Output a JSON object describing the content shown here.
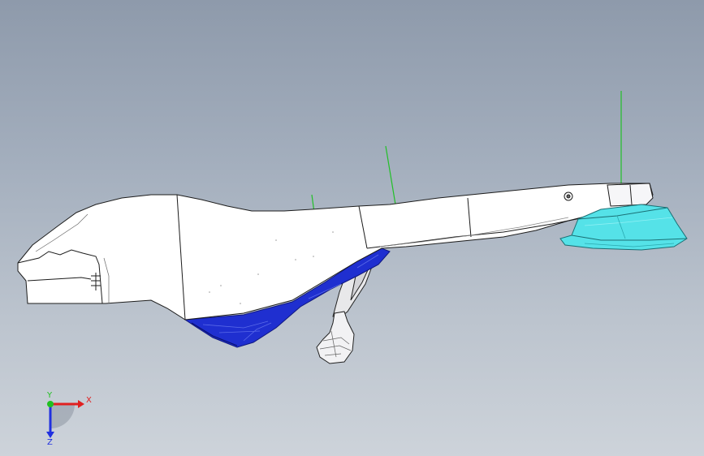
{
  "viewport": {
    "background_top": "#8e9aab",
    "background_bottom": "#cdd3da"
  },
  "model": {
    "body_color": "#ffffff",
    "underside_color": "#1f2fd0",
    "pad_color": "#55e2e8",
    "leg_color": "#e8e8ea",
    "edge_color": "#222222",
    "marker_color": "#22c028"
  },
  "triad": {
    "x_label": "X",
    "y_label": "Y",
    "z_label": "Z",
    "x_color": "#e02020",
    "y_color": "#20c020",
    "z_color": "#2030e0"
  }
}
